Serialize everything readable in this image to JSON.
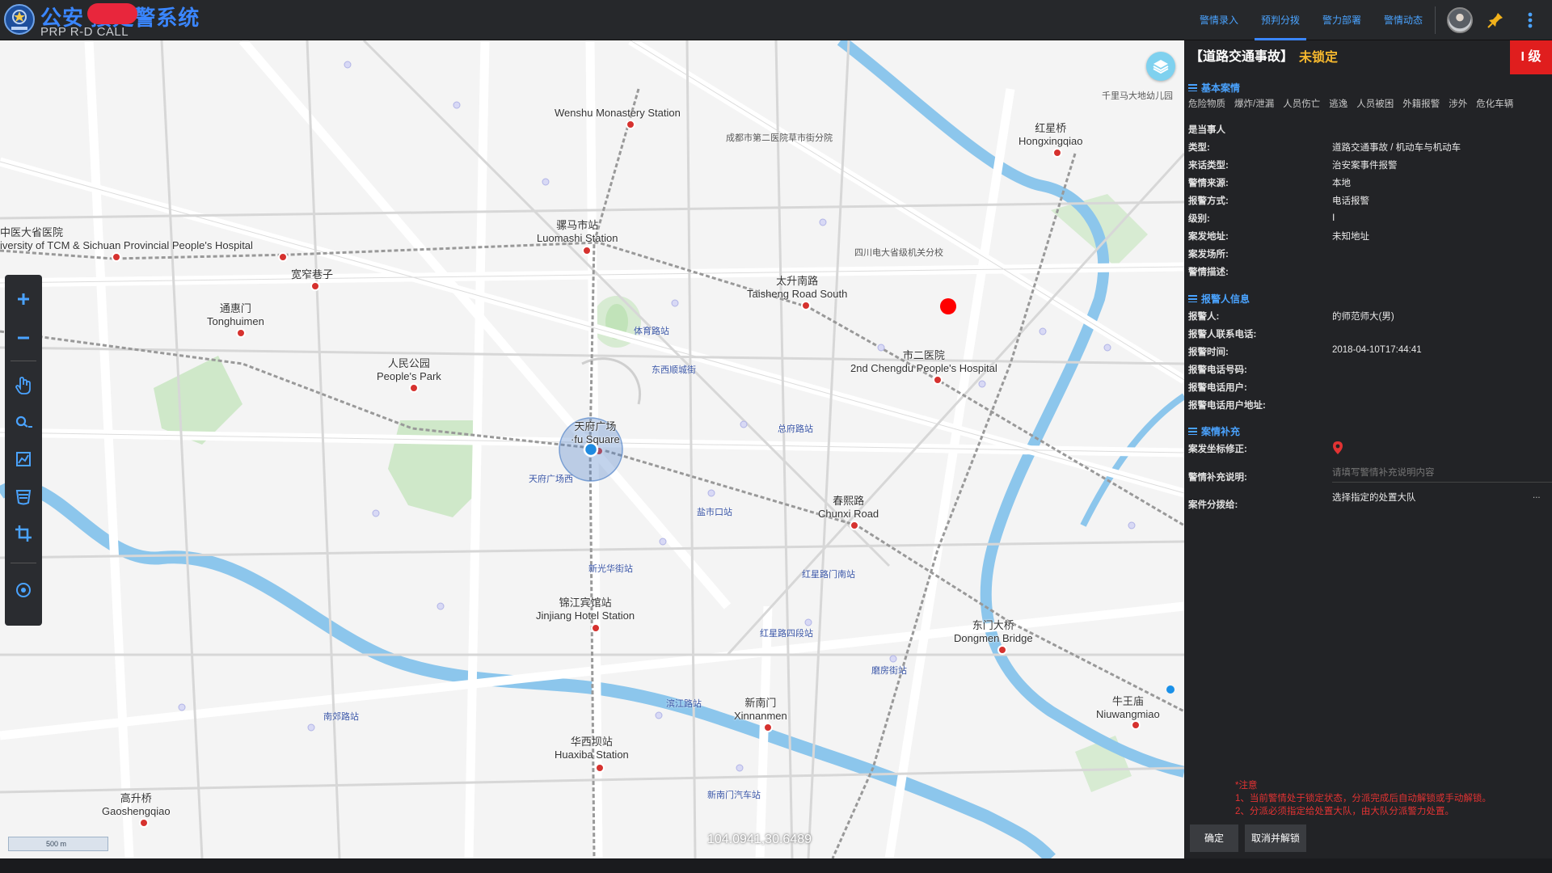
{
  "header": {
    "title": "公安 接处警系统",
    "subtitle": "PRP R-D CALL",
    "nav": [
      {
        "label": "警情录入",
        "active": false
      },
      {
        "label": "预判分拨",
        "active": true
      },
      {
        "label": "警力部署",
        "active": false
      },
      {
        "label": "警情动态",
        "active": false
      }
    ]
  },
  "map": {
    "coordinates": "104.0941,30.6489",
    "scale_label": "500 m",
    "stations": [
      {
        "label": "Wenshu Monastery Station"
      },
      {
        "label": "骡马市站\nLuomashi Station"
      },
      {
        "label": "太升南路\nTaisheng Road South"
      },
      {
        "label": "中医大省医院\niversity of TCM & Sichuan Provincial People's Hospital"
      },
      {
        "label": "宽窄巷子"
      },
      {
        "label": "通惠门\nTonghuimen"
      },
      {
        "label": "人民公园\nPeople's Park"
      },
      {
        "label": "天府广场\n·fu Square"
      },
      {
        "label": "市二医院\n2nd Chengdu People's Hospital"
      },
      {
        "label": "春熙路\nChunxi Road"
      },
      {
        "label": "锦江宾馆站\nJinjiang Hotel Station"
      },
      {
        "label": "东门大桥\nDongmen Bridge"
      },
      {
        "label": "新南门\nXinnanmen"
      },
      {
        "label": "华西坝站\nHuaxiba Station"
      },
      {
        "label": "高升桥\nGaoshengqiao"
      },
      {
        "label": "牛王庙\nNiuwangmiao"
      },
      {
        "label": "红星桥\nHongxingqiao"
      }
    ],
    "bus_labels": [
      "体育路站",
      "东西顺城街",
      "总府路站",
      "天府广场西",
      "盐市口站",
      "新光华街站",
      "红星路门南站",
      "红星路四段站",
      "磨房街站",
      "滨江路站",
      "南郊路站",
      "新南门汽车站"
    ],
    "place_labels": [
      "成都市第二医院草市街分院",
      "四川电大省级机关分校",
      "千里马大地幼儿园"
    ]
  },
  "panel": {
    "case_type_title": "【道路交通事故】",
    "lock_status": "未锁定",
    "level": "I 级",
    "basic_section": "基本案情",
    "tags": [
      "危险物质",
      "爆炸/泄漏",
      "人员伤亡",
      "逃逸",
      "人员被困",
      "外籍报警",
      "涉外",
      "危化车辆"
    ],
    "party_label": "是当事人",
    "basic_rows": [
      {
        "label": "类型:",
        "value": "道路交通事故 / 机动车与机动车"
      },
      {
        "label": "来话类型:",
        "value": "治安案事件报警"
      },
      {
        "label": "警情来源:",
        "value": "本地"
      },
      {
        "label": "报警方式:",
        "value": "电话报警"
      },
      {
        "label": "级别:",
        "value": "Ⅰ"
      },
      {
        "label": "案发地址:",
        "value": "未知地址"
      },
      {
        "label": "案发场所:",
        "value": ""
      },
      {
        "label": "警情描述:",
        "value": ""
      }
    ],
    "reporter_section": "报警人信息",
    "reporter_rows": [
      {
        "label": "报警人:",
        "value": "的师范师大(男)"
      },
      {
        "label": "报警人联系电话:",
        "value": ""
      },
      {
        "label": "报警时间:",
        "value": "2018-04-10T17:44:41"
      },
      {
        "label": "报警电话号码:",
        "value": ""
      },
      {
        "label": "报警电话用户:",
        "value": ""
      },
      {
        "label": "报警电话用户地址:",
        "value": ""
      }
    ],
    "supplement_section": "案情补充",
    "coord_fix_label": "案发坐标修正:",
    "supplement_label": "警情补充说明:",
    "supplement_placeholder": "请填写警情补充说明内容",
    "dispatch_label": "案件分拨给:",
    "dispatch_value": "选择指定的处置大队",
    "dispatch_more": "...",
    "notes": [
      "*注意",
      "1、当前警情处于锁定状态，分派完成后自动解锁或手动解锁。",
      "2、分派必须指定给处置大队，由大队分派警力处置。"
    ],
    "confirm_label": "确定",
    "cancel_label": "取消并解锁"
  }
}
